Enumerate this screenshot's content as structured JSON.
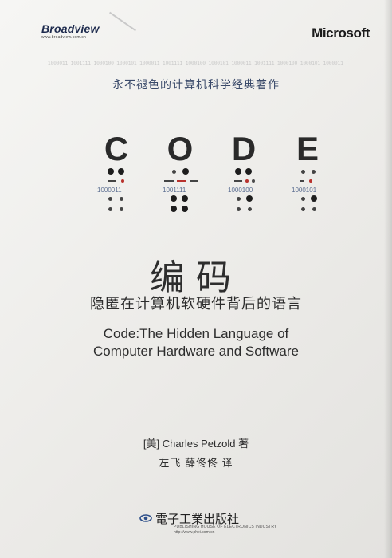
{
  "publisher_top": {
    "name": "Broadview",
    "url": "www.broadview.com.cn"
  },
  "partner_logo": "Microsoft",
  "binary_strip": "1000011 1001111 1000100 1000101 1000011 1001111 1000100 1000101 1000011 1001111 1000100 1000101 1000011 1001111 1000100 1000101",
  "tagline": "永不褪色的计算机科学经典著作",
  "code_letters": [
    {
      "letter": "C",
      "binary": "1000011"
    },
    {
      "letter": "O",
      "binary": "1001111"
    },
    {
      "letter": "D",
      "binary": "1000100"
    },
    {
      "letter": "E",
      "binary": "1000101"
    }
  ],
  "title_cn": "编码",
  "subtitle_cn": "隐匿在计算机软硬件背后的语言",
  "title_en_line1": "Code:The Hidden Language of",
  "title_en_line2": "Computer Hardware and Software",
  "author_line": "[美] Charles Petzold  著",
  "translators_line": "左飞  薛佟佟  译",
  "publisher_bottom": {
    "name": "電子工業出版社",
    "english": "PUBLISHING HOUSE OF ELECTRONICS INDUSTRY",
    "url": "http://www.phei.com.cn"
  }
}
